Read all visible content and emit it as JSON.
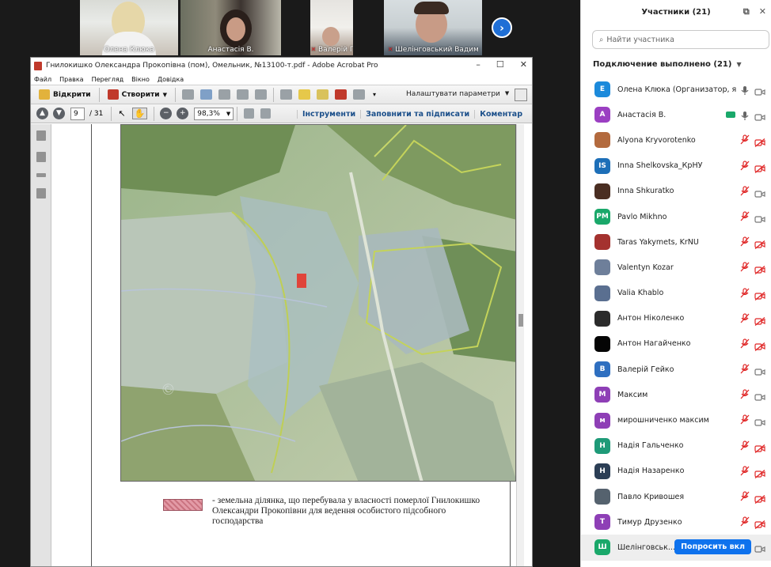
{
  "videos": [
    {
      "name": "Олена Клюка",
      "muted": false
    },
    {
      "name": "Анастасія В.",
      "muted": false
    },
    {
      "name": "Валерій Гейко",
      "muted": true
    },
    {
      "name": "Шелінговський Вадим",
      "muted": true
    }
  ],
  "acrobat": {
    "title": "Гнилокишко Олександра Прокопівна (пом), Омельник,  №13100-т.pdf - Adobe Acrobat Pro",
    "menu": [
      "Файл",
      "Правка",
      "Перегляд",
      "Вікно",
      "Довідка"
    ],
    "open_label": "Відкрити",
    "create_label": "Створити",
    "customize_label": "Налаштувати параметри",
    "page_current": "9",
    "page_total": "/ 31",
    "zoom": "98,3%",
    "tools_label": "Інструменти",
    "fill_sign_label": "Заповнити та підписати",
    "comment_label": "Коментар",
    "legend_text": "- земельна ділянка, що перебувала у власності померлої Гнилокишко Олександри Прокопівни для ведення особистого підсобного господарства"
  },
  "panel": {
    "title": "Участники (21)",
    "search_placeholder": "Найти участника",
    "connected_label": "Подключение выполнено (21)",
    "ask_button": "Попросить вкл",
    "participants": [
      {
        "name": "Олена Клюка (Организатор, я)",
        "initials": "Е",
        "color": "#1c8adb",
        "mic": "on",
        "cam": "on"
      },
      {
        "name": "Анастасія В.",
        "initials": "А",
        "color": "#9b3fc2",
        "mic": "on",
        "cam": "on",
        "share": true
      },
      {
        "name": "Alyona Kryvorotenko",
        "initials": "",
        "color": "#b36a3e",
        "photo": true,
        "mic": "off",
        "cam": "off"
      },
      {
        "name": "Inna Shelkovska_КрНУ",
        "initials": "IS",
        "color": "#1d6fb8",
        "mic": "off",
        "cam": "off"
      },
      {
        "name": "Inna Shkuratko",
        "initials": "",
        "color": "#4a2e22",
        "photo": true,
        "mic": "off",
        "cam": "on"
      },
      {
        "name": "Pavlo Mikhno",
        "initials": "PM",
        "color": "#1aa86a",
        "mic": "off",
        "cam": "on"
      },
      {
        "name": "Taras Yakymets, KrNU",
        "initials": "",
        "color": "#a4322f",
        "photo": true,
        "mic": "off",
        "cam": "off"
      },
      {
        "name": "Valentyn Kozar",
        "initials": "",
        "color": "#6e7f9a",
        "photo": true,
        "mic": "off",
        "cam": "off"
      },
      {
        "name": "Valia Khablo",
        "initials": "",
        "color": "#5a6f90",
        "photo": true,
        "mic": "off",
        "cam": "off"
      },
      {
        "name": "Антон Ніколенко",
        "initials": "",
        "color": "#2b2b2b",
        "photo": true,
        "mic": "off",
        "cam": "off"
      },
      {
        "name": "Антон Нагайченко",
        "initials": "",
        "color": "#050505",
        "photo": true,
        "mic": "off",
        "cam": "off"
      },
      {
        "name": "Валерій Гейко",
        "initials": "В",
        "color": "#2e6fc0",
        "mic": "off",
        "cam": "on"
      },
      {
        "name": "Максим",
        "initials": "М",
        "color": "#8e3fb6",
        "mic": "off",
        "cam": "on"
      },
      {
        "name": "мирошниченко максим",
        "initials": "м",
        "color": "#8e3fb6",
        "mic": "off",
        "cam": "on"
      },
      {
        "name": "Надія Гальченко",
        "initials": "Н",
        "color": "#1e9a78",
        "mic": "off",
        "cam": "off"
      },
      {
        "name": "Надія Назаренко",
        "initials": "Н",
        "color": "#2b3e55",
        "mic": "off",
        "cam": "off"
      },
      {
        "name": "Павло Кривошея",
        "initials": "",
        "color": "#55626e",
        "photo": true,
        "mic": "off",
        "cam": "off"
      },
      {
        "name": "Тимур Друзенко",
        "initials": "Т",
        "color": "#8e3fb6",
        "mic": "off",
        "cam": "off"
      },
      {
        "name": "Шелінговськ...",
        "initials": "Ш",
        "color": "#1aa86a",
        "mic": "none",
        "cam": "on",
        "ask": true
      }
    ]
  }
}
